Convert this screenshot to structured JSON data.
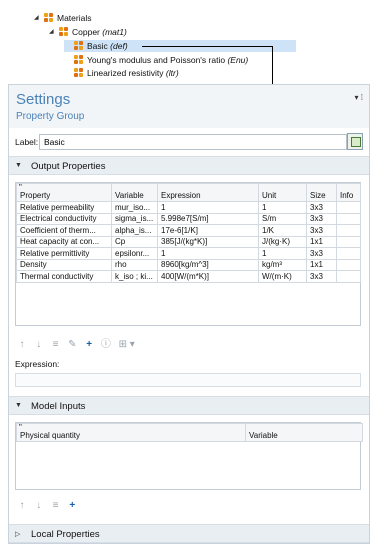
{
  "tree": {
    "materials": "Materials",
    "copper_name": "Copper",
    "copper_tag": "(mat1)",
    "basic_name": "Basic",
    "basic_tag": "(def)",
    "youngs_name": "Young's modulus and Poisson's ratio",
    "youngs_tag": "(Enu)",
    "linres_name": "Linearized resistivity",
    "linres_tag": "(ltr)"
  },
  "settings": {
    "title": "Settings",
    "subtitle": "Property Group",
    "controls": "▾ ⁞",
    "label_caption": "Label:",
    "label_value": "Basic"
  },
  "output_properties": {
    "section_title": "Output Properties",
    "columns": [
      "Property",
      "Variable",
      "Expression",
      "Unit",
      "Size",
      "Info"
    ],
    "rows": [
      [
        "Relative permeability",
        "mur_iso...",
        "1",
        "1",
        "3x3",
        ""
      ],
      [
        "Electrical conductivity",
        "sigma_is...",
        "5.998e7[S/m]",
        "S/m",
        "3x3",
        ""
      ],
      [
        "Coefficient of therm...",
        "alpha_is...",
        "17e-6[1/K]",
        "1/K",
        "3x3",
        ""
      ],
      [
        "Heat capacity at con...",
        "Cp",
        "385[J/(kg*K)]",
        "J/(kg·K)",
        "1x1",
        ""
      ],
      [
        "Relative permittivity",
        "epsilonr...",
        "1",
        "1",
        "3x3",
        ""
      ],
      [
        "Density",
        "rho",
        "8960[kg/m^3]",
        "kg/m³",
        "1x1",
        ""
      ],
      [
        "Thermal conductivity",
        "k_iso ; ki...",
        "400[W/(m*K)]",
        "W/(m·K)",
        "3x3",
        ""
      ]
    ],
    "expression_caption": "Expression:"
  },
  "model_inputs": {
    "section_title": "Model Inputs",
    "columns": [
      "Physical quantity",
      "Variable"
    ]
  },
  "local_properties": {
    "section_title": "Local Properties"
  },
  "icons": {
    "expand": "▼",
    "collapse": "▷",
    "sort": "\"",
    "up": "↑",
    "down": "↓",
    "list": "≡",
    "edit": "✎",
    "add": "+",
    "info": "ⓘ",
    "more": "⊞ ▾"
  },
  "colors": {
    "accent": "#4a82b8",
    "selection": "#cfe3f8",
    "section_bg": "#e9eef3"
  }
}
